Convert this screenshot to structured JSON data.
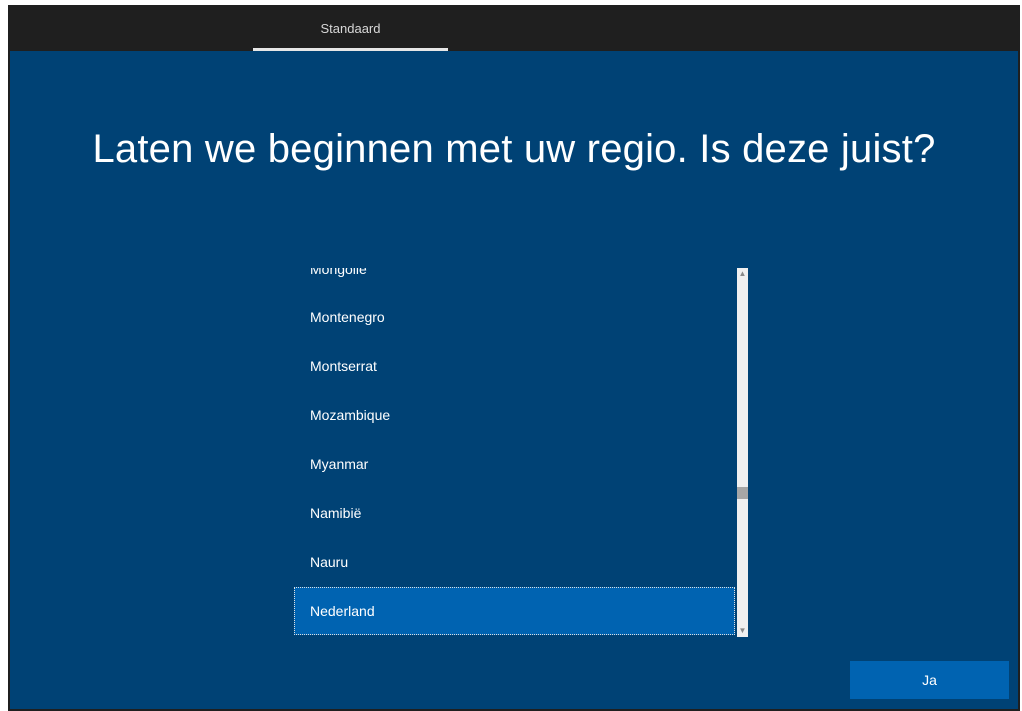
{
  "topbar": {
    "tab_label": "Standaard"
  },
  "main": {
    "title": "Laten we beginnen met uw regio. Is deze juist?"
  },
  "region_list": {
    "items": [
      {
        "label": "Mongolië"
      },
      {
        "label": "Montenegro"
      },
      {
        "label": "Montserrat"
      },
      {
        "label": "Mozambique"
      },
      {
        "label": "Myanmar"
      },
      {
        "label": "Namibië"
      },
      {
        "label": "Nauru"
      },
      {
        "label": "Nederland"
      }
    ],
    "selected_label": "Nederland"
  },
  "scrollbar": {
    "up_icon": "chevron-up-icon",
    "down_icon": "chevron-down-icon"
  },
  "footer": {
    "confirm_label": "Ja"
  },
  "colors": {
    "background": "#004275",
    "accent": "#0063b1",
    "topbar": "#1f1f1f"
  }
}
